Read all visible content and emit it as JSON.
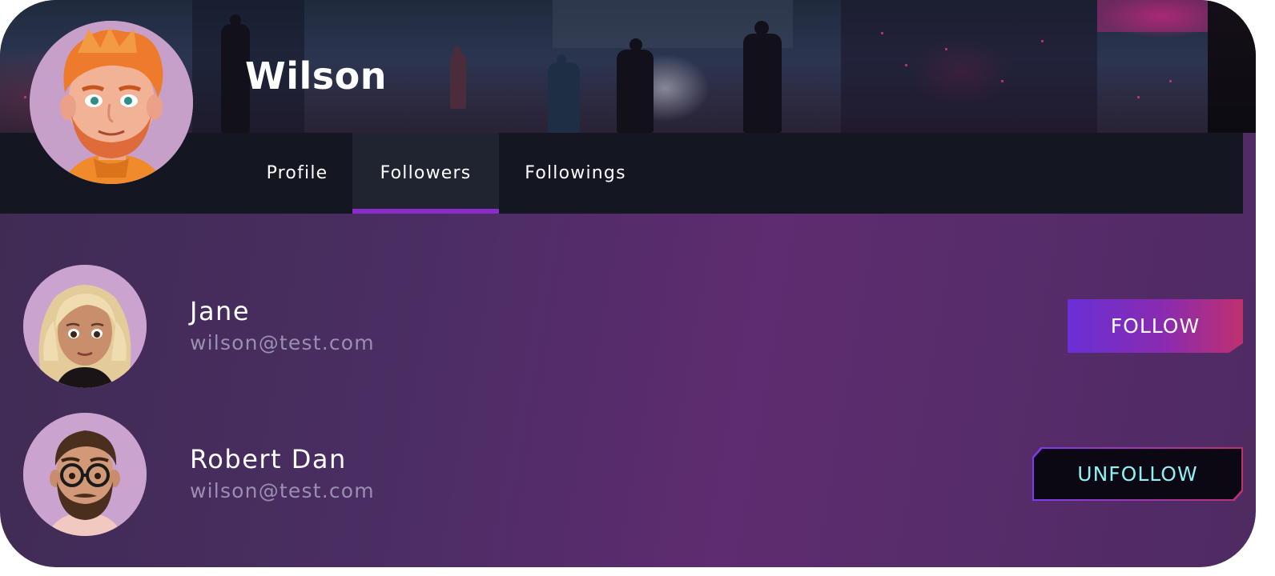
{
  "profile": {
    "name": "Wilson"
  },
  "tabs": [
    {
      "label": "Profile",
      "active": false
    },
    {
      "label": "Followers",
      "active": true
    },
    {
      "label": "Followings",
      "active": false
    }
  ],
  "followers": [
    {
      "name": "Jane",
      "email": "wilson@test.com",
      "action": "FOLLOW"
    },
    {
      "name": "Robert Dan",
      "email": "wilson@test.com",
      "action": "UNFOLLOW"
    }
  ],
  "colors": {
    "accent": "#8a2cc9",
    "navbar": "#141722",
    "unfollow_text": "#8ff0f5"
  }
}
